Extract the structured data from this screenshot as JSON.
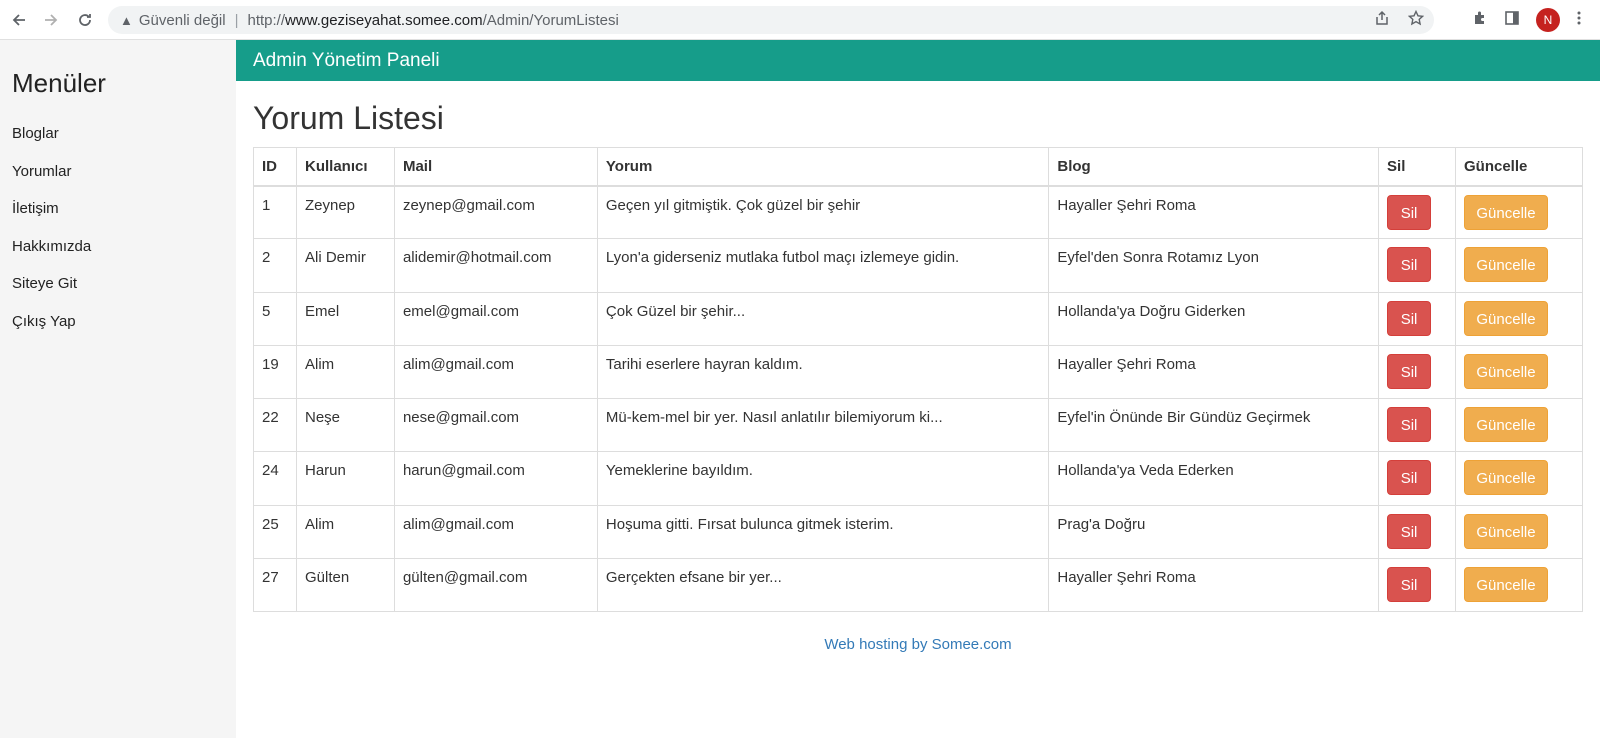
{
  "browser": {
    "not_secure": "Güvenli değil",
    "separator": "|",
    "url_proto": "http://",
    "url_host": "www.geziseyahat.somee.com",
    "url_path": "/Admin/YorumListesi",
    "avatar_letter": "N",
    "icons": [
      "back-icon",
      "forward-icon",
      "reload-icon",
      "warning-icon",
      "share-icon",
      "star-icon",
      "puzzle-icon",
      "sidepanel-icon",
      "menu-icon"
    ]
  },
  "sidebar": {
    "title": "Menüler",
    "items": [
      {
        "label": "Bloglar"
      },
      {
        "label": "Yorumlar"
      },
      {
        "label": "İletişim"
      },
      {
        "label": "Hakkımızda"
      },
      {
        "label": "Siteye Git"
      },
      {
        "label": "Çıkış Yap"
      }
    ]
  },
  "header": {
    "title": "Admin Yönetim Paneli"
  },
  "main": {
    "title": "Yorum Listesi",
    "columns": [
      "ID",
      "Kullanıcı",
      "Mail",
      "Yorum",
      "Blog",
      "Sil",
      "Güncelle"
    ],
    "delete_label": "Sil",
    "update_label": "Güncelle",
    "rows": [
      {
        "id": "1",
        "user": "Zeynep",
        "mail": "zeynep@gmail.com",
        "comment": "Geçen yıl gitmiştik. Çok güzel bir şehir",
        "blog": "Hayaller Şehri Roma"
      },
      {
        "id": "2",
        "user": "Ali Demir",
        "mail": "alidemir@hotmail.com",
        "comment": "Lyon'a giderseniz mutlaka futbol maçı izlemeye gidin.",
        "blog": "Eyfel'den Sonra Rotamız Lyon"
      },
      {
        "id": "5",
        "user": "Emel",
        "mail": "emel@gmail.com",
        "comment": "Çok Güzel bir şehir...",
        "blog": "Hollanda'ya Doğru Giderken"
      },
      {
        "id": "19",
        "user": "Alim",
        "mail": "alim@gmail.com",
        "comment": "Tarihi eserlere hayran kaldım.",
        "blog": "Hayaller Şehri Roma"
      },
      {
        "id": "22",
        "user": "Neşe",
        "mail": "nese@gmail.com",
        "comment": "Mü-kem-mel bir yer. Nasıl anlatılır bilemiyorum ki...",
        "blog": "Eyfel'in Önünde Bir Gündüz Geçirmek"
      },
      {
        "id": "24",
        "user": "Harun",
        "mail": "harun@gmail.com",
        "comment": "Yemeklerine bayıldım.",
        "blog": "Hollanda'ya Veda Ederken"
      },
      {
        "id": "25",
        "user": "Alim",
        "mail": "alim@gmail.com",
        "comment": "Hoşuma gitti. Fırsat bulunca gitmek isterim.",
        "blog": "Prag'a Doğru"
      },
      {
        "id": "27",
        "user": "Gülten",
        "mail": "gülten@gmail.com",
        "comment": "Gerçekten efsane bir yer...",
        "blog": "Hayaller Şehri Roma"
      }
    ]
  },
  "footer": {
    "link": "Web hosting by Somee.com"
  },
  "colors": {
    "header_bg": "#169d8a",
    "danger": "#d9534f",
    "warning": "#f0ad4e",
    "link": "#337ab7",
    "sidebar_bg": "#f5f5f5"
  }
}
